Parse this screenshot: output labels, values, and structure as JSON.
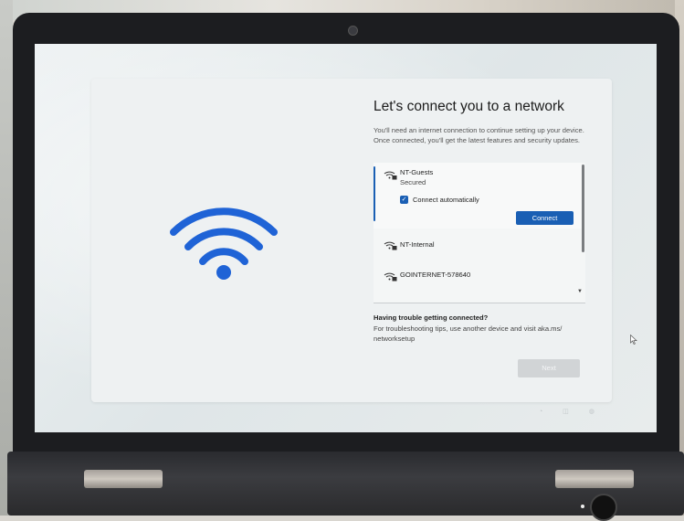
{
  "setup": {
    "title": "Let's connect you to a network",
    "description": "You'll need an internet connection to continue setting up your device. Once connected, you'll get the latest features and security updates."
  },
  "networks": [
    {
      "name": "NT-Guests",
      "status": "Secured",
      "icon": "wifi-secured-icon",
      "selected": true,
      "auto_connect_label": "Connect automatically",
      "auto_connect_checked": true,
      "connect_label": "Connect"
    },
    {
      "name": "NT-Internal",
      "icon": "wifi-secured-icon"
    },
    {
      "name": "GOINTERNET-578640",
      "icon": "wifi-secured-icon"
    }
  ],
  "trouble": {
    "title": "Having trouble getting connected?",
    "text": "For troubleshooting tips, use another device and visit aka.ms/ networksetup"
  },
  "next_label": "Next",
  "colors": {
    "accent": "#1a5fb4",
    "wifi_hero": "#1f63d6"
  },
  "icons": {
    "hero": "wifi-icon",
    "scroll_down": "chevron-down-icon"
  }
}
